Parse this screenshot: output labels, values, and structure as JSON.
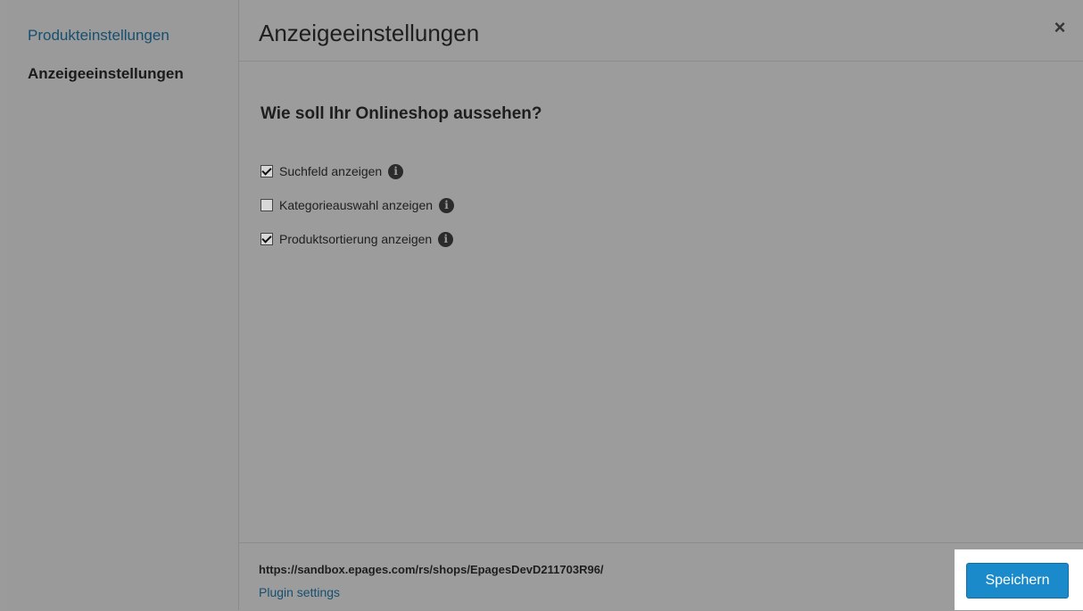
{
  "sidebar": {
    "items": [
      {
        "label": "Produkteinstellungen"
      },
      {
        "label": "Anzeigeeinstellungen"
      }
    ]
  },
  "header": {
    "title": "Anzeigeeinstellungen",
    "close_icon": "×"
  },
  "section": {
    "title": "Wie soll Ihr Onlineshop aussehen?"
  },
  "options": [
    {
      "label": "Suchfeld anzeigen",
      "checked": true
    },
    {
      "label": "Kategorieauswahl anzeigen",
      "checked": false
    },
    {
      "label": "Produktsortierung anzeigen",
      "checked": true
    }
  ],
  "icons": {
    "info": "i"
  },
  "footer": {
    "shop_url": "https://sandbox.epages.com/rs/shops/EpagesDevD211703R96/",
    "plugin_link": "Plugin settings",
    "save_label": "Speichern"
  },
  "colors": {
    "accent": "#1a8acb",
    "link": "#174f70",
    "overlay": "#9b9b9b"
  }
}
